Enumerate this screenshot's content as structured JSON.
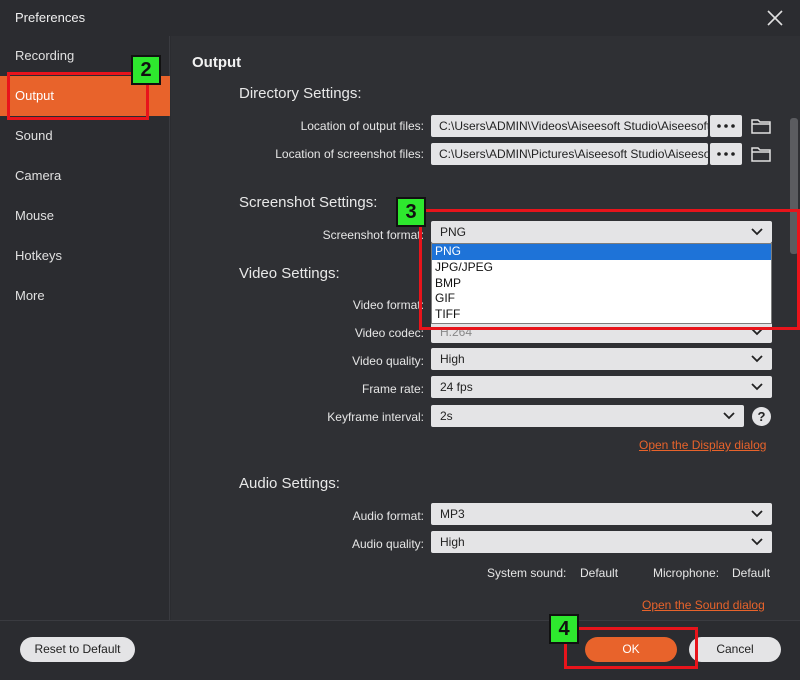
{
  "window": {
    "title": "Preferences",
    "close_icon": "close-icon"
  },
  "sidebar": {
    "items": [
      {
        "label": "Recording",
        "active": false
      },
      {
        "label": "Output",
        "active": true
      },
      {
        "label": "Sound",
        "active": false
      },
      {
        "label": "Camera",
        "active": false
      },
      {
        "label": "Mouse",
        "active": false
      },
      {
        "label": "Hotkeys",
        "active": false
      },
      {
        "label": "More",
        "active": false
      }
    ]
  },
  "main": {
    "section_title": "Output",
    "directory": {
      "title": "Directory Settings:",
      "output_label": "Location of output files:",
      "output_value": "C:\\Users\\ADMIN\\Videos\\Aiseesoft Studio\\Aiseesoft S",
      "screenshot_label": "Location of screenshot files:",
      "screenshot_value": "C:\\Users\\ADMIN\\Pictures\\Aiseesoft Studio\\Aiseesoft"
    },
    "screenshot": {
      "title": "Screenshot Settings:",
      "format_label": "Screenshot format:",
      "format_value": "PNG",
      "options": [
        "PNG",
        "JPG/JPEG",
        "BMP",
        "GIF",
        "TIFF"
      ],
      "selected_option": "PNG"
    },
    "video": {
      "title": "Video Settings:",
      "format_label": "Video format:",
      "codec_label": "Video codec:",
      "codec_value": "H.264",
      "quality_label": "Video quality:",
      "quality_value": "High",
      "framerate_label": "Frame rate:",
      "framerate_value": "24 fps",
      "keyframe_label": "Keyframe interval:",
      "keyframe_value": "2s",
      "help_symbol": "?",
      "display_link": "Open the Display dialog"
    },
    "audio": {
      "title": "Audio Settings:",
      "format_label": "Audio format:",
      "format_value": "MP3",
      "quality_label": "Audio quality:",
      "quality_value": "High",
      "system_sound_label": "System sound:",
      "system_sound_value": "Default",
      "microphone_label": "Microphone:",
      "microphone_value": "Default",
      "sound_link": "Open the Sound dialog"
    }
  },
  "footer": {
    "reset_label": "Reset to Default",
    "ok_label": "OK",
    "cancel_label": "Cancel"
  },
  "annotations": {
    "badges": [
      "2",
      "3",
      "4"
    ],
    "highlight_color": "#e8141b",
    "badge_color": "#2ee82e"
  },
  "colors": {
    "accent": "#e8632b",
    "selection": "#1e73d8"
  }
}
